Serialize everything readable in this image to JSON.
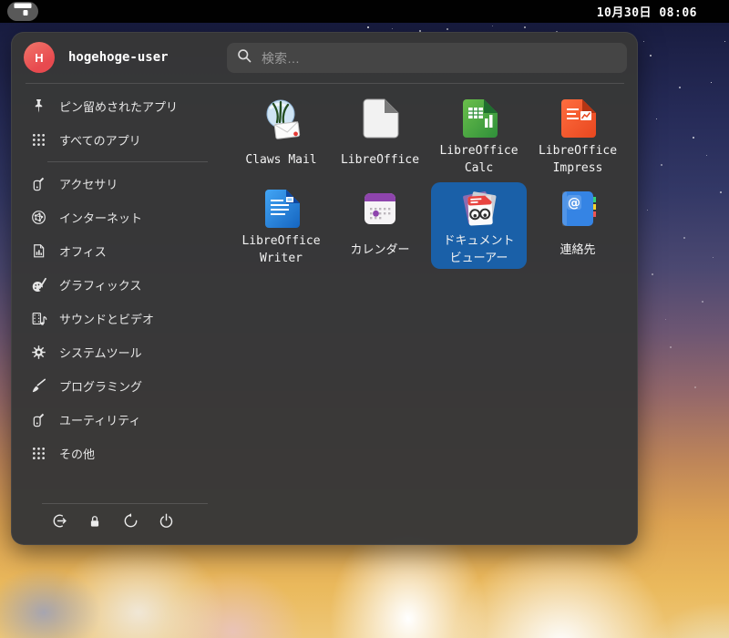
{
  "topbar": {
    "clock": "10月30日 08:06",
    "menu_button_icon": "arcmenu-grid-icon"
  },
  "menu": {
    "user": {
      "name": "hogehoge-user",
      "initial": "H"
    },
    "search": {
      "placeholder": "検索…",
      "icon": "search-icon"
    },
    "nav": [
      {
        "label": "ピン留めされたアプリ",
        "icon": "pin-icon"
      },
      {
        "label": "すべてのアプリ",
        "icon": "apps-grid-icon"
      }
    ],
    "categories": [
      {
        "label": "アクセサリ",
        "icon": "utility-knife-icon"
      },
      {
        "label": "インターネット",
        "icon": "network-globe-icon"
      },
      {
        "label": "オフィス",
        "icon": "office-document-icon"
      },
      {
        "label": "グラフィックス",
        "icon": "palette-icon"
      },
      {
        "label": "サウンドとビデオ",
        "icon": "media-icon"
      },
      {
        "label": "システムツール",
        "icon": "gear-icon"
      },
      {
        "label": "プログラミング",
        "icon": "pen-icon"
      },
      {
        "label": "ユーティリティ",
        "icon": "utility-knife-icon"
      },
      {
        "label": "その他",
        "icon": "apps-grid-icon"
      }
    ],
    "apps": [
      {
        "name": "Claws Mail",
        "lines": [
          "Claws Mail"
        ],
        "icon": "claws-mail-icon",
        "selected": false
      },
      {
        "name": "LibreOffice",
        "lines": [
          "LibreOffice"
        ],
        "icon": "libreoffice-icon",
        "selected": false
      },
      {
        "name": "LibreOffice Calc",
        "lines": [
          "LibreOffice",
          "Calc"
        ],
        "icon": "libreoffice-calc-icon",
        "selected": false
      },
      {
        "name": "LibreOffice Impress",
        "lines": [
          "LibreOffice",
          "Impress"
        ],
        "icon": "libreoffice-impress-icon",
        "selected": false
      },
      {
        "name": "LibreOffice Writer",
        "lines": [
          "LibreOffice",
          "Writer"
        ],
        "icon": "libreoffice-writer-icon",
        "selected": false
      },
      {
        "name": "カレンダー",
        "lines": [
          "カレンダー"
        ],
        "icon": "calendar-icon",
        "selected": false
      },
      {
        "name": "ドキュメントビューアー",
        "lines": [
          "ドキュメント",
          "ビューアー"
        ],
        "icon": "document-viewer-icon",
        "selected": true
      },
      {
        "name": "連絡先",
        "lines": [
          "連絡先"
        ],
        "icon": "contacts-icon",
        "icon_glyph": "@",
        "selected": false
      }
    ],
    "session": [
      {
        "icon": "logout-icon"
      },
      {
        "icon": "lock-icon"
      },
      {
        "icon": "restart-icon"
      },
      {
        "icon": "power-icon"
      }
    ]
  },
  "colors": {
    "selected_tile": "#1a60a8",
    "panel": "#383838",
    "topbar": "#000000",
    "avatar": "#e84a4f",
    "calc_green": "#3f9c46",
    "impress_orange": "#ee4e1d",
    "writer_blue": "#1c7ed6",
    "contacts_blue": "#3584e4",
    "calendar_purple": "#8e44ad"
  }
}
